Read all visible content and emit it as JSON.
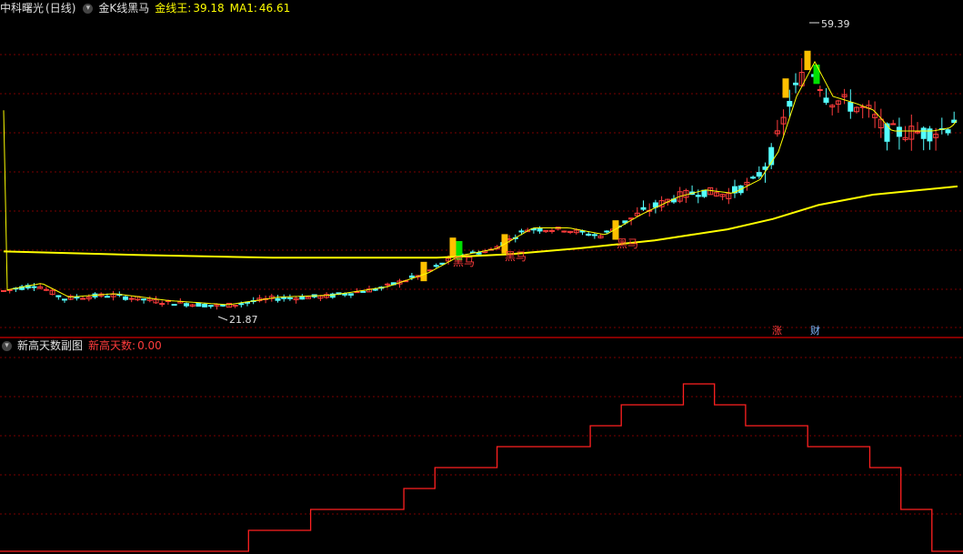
{
  "colors": {
    "background": "#000000",
    "grid": "#7a0000",
    "divider": "#b00000",
    "up": "#ff3c3c",
    "down": "#54ffff",
    "ma": "#ffff00",
    "slow_ma": "#ffff00",
    "signal_gold": "#ffc000",
    "signal_green": "#00e000",
    "sub_line": "#ff2020",
    "text_white": "#e0e0e0",
    "text_yellow": "#ffff00",
    "text_red": "#ff3c3c",
    "badge_red": "#ff3c3c",
    "badge_blue": "#7fb8ff"
  },
  "header": {
    "stock_name": "中科曙光",
    "period": "(日线)",
    "indicator_name": "金K线黑马",
    "gold_line_label": "金线王:",
    "gold_line_value": "39.18",
    "ma1_label": "MA1:",
    "ma1_value": "46.61"
  },
  "sub_header": {
    "indicator_name": "新高天数副图",
    "series_label": "新高天数:",
    "series_value": "0.00"
  },
  "annotations": {
    "high_label": "59.39",
    "low_label": "21.87",
    "black_horse": "黑马",
    "limit_up_badge": "涨",
    "finance_badge": "财"
  },
  "chart_data": [
    {
      "type": "candlestick",
      "title": "金K线黑马",
      "price_range": [
        17.5,
        63.5
      ],
      "series": [
        {
          "name": "金线王",
          "value": 39.18
        },
        {
          "name": "MA1",
          "value": 46.61
        }
      ],
      "high": 59.39,
      "low": 21.87,
      "signals": [
        "黑马",
        "黑马",
        "黑马"
      ],
      "grid": true
    },
    {
      "type": "line",
      "title": "新高天数副图",
      "series": [
        {
          "name": "新高天数",
          "value": 0.0
        }
      ],
      "y_range": [
        0,
        10
      ],
      "step_values": [
        0,
        0,
        0,
        0,
        0,
        0,
        0,
        0,
        1,
        1,
        2,
        2,
        2,
        3,
        4,
        4,
        5,
        5,
        5,
        6,
        7,
        7,
        8,
        7,
        6,
        6,
        5,
        5,
        4,
        2,
        0
      ],
      "grid": true
    }
  ]
}
